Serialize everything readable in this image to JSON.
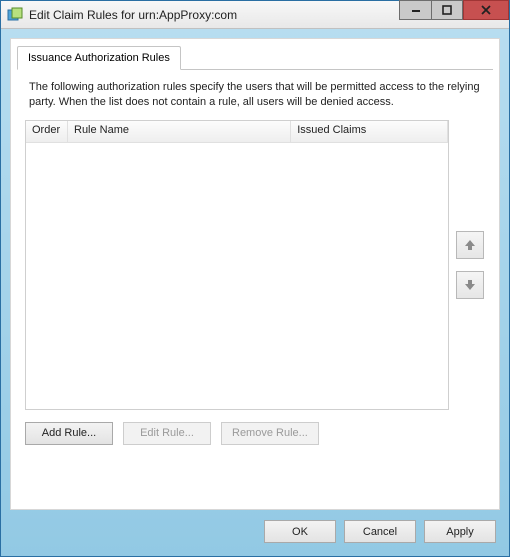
{
  "window": {
    "title": "Edit Claim Rules for urn:AppProxy:com"
  },
  "tabs": {
    "issuance": "Issuance Authorization Rules"
  },
  "description": "The following authorization rules specify the users that will be permitted access to the relying party. When the list does not contain a rule, all users will be denied access.",
  "columns": {
    "order": "Order",
    "ruleName": "Rule Name",
    "issuedClaims": "Issued Claims"
  },
  "ruleButtons": {
    "add": "Add Rule...",
    "edit": "Edit Rule...",
    "remove": "Remove Rule..."
  },
  "footerButtons": {
    "ok": "OK",
    "cancel": "Cancel",
    "apply": "Apply"
  }
}
